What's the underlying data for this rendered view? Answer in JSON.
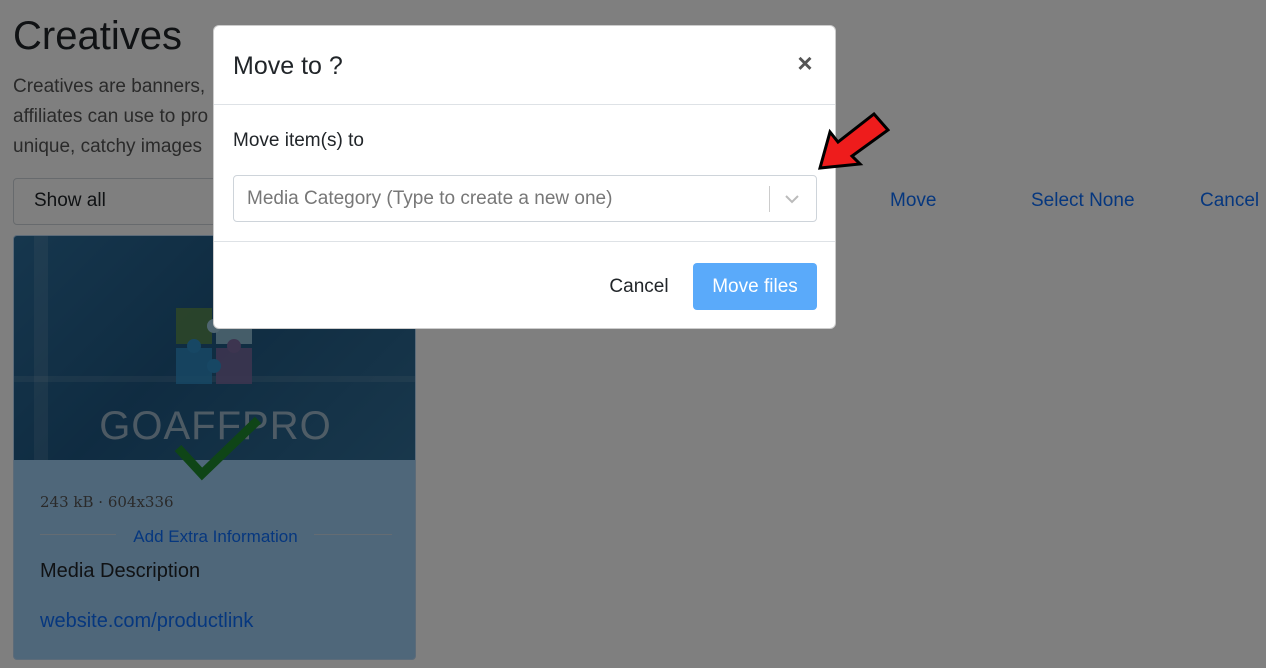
{
  "page": {
    "title": "Creatives",
    "description_lines": [
      "Creatives are banners,",
      "affiliates can use to pro",
      "unique, catchy images"
    ],
    "filter_value": "Show all",
    "actions": {
      "move": "Move",
      "select_none": "Select None",
      "cancel": "Cancel"
    }
  },
  "card": {
    "watermark": "GOAFFPRO",
    "meta": "243 kB · 604x336",
    "extra_info": "Add Extra Information",
    "description": "Media Description",
    "link": "website.com/productlink",
    "selected": true
  },
  "modal": {
    "title": "Move to ?",
    "close_icon": "×",
    "field_label": "Move item(s) to",
    "select_placeholder": "Media Category (Type to create a new one)",
    "cancel_label": "Cancel",
    "submit_label": "Move files"
  },
  "colors": {
    "accent": "#0d6efd",
    "submit_button": "#5aaafa",
    "annotation_arrow": "#ee1c1c",
    "selected_check": "#1e8a2e"
  },
  "icons": {
    "close": "close-icon",
    "select_dropdown": "chevron-down-icon",
    "selected": "check-icon",
    "annotation": "red-arrow-icon",
    "logo": "puzzle-icon"
  }
}
